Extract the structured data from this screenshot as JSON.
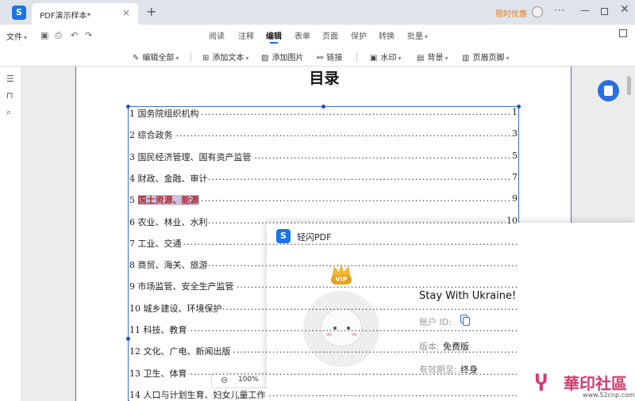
{
  "titlebar": {
    "app_logo": "S",
    "tab_title": "PDF演示样本*",
    "tab_close": "×",
    "tab_add": "+",
    "promo": "限时优惠",
    "more": "···",
    "minimize": "—",
    "close": "✕"
  },
  "menu": {
    "file": "文件",
    "file_caret": "▾",
    "items": [
      {
        "label": "阅读"
      },
      {
        "label": "注释"
      },
      {
        "label": "编辑"
      },
      {
        "label": "表单"
      },
      {
        "label": "页面"
      },
      {
        "label": "保护"
      },
      {
        "label": "转换"
      },
      {
        "label": "批量"
      }
    ],
    "batch_caret": "▾",
    "active_index": 2
  },
  "toolbar": {
    "edit_all": "编辑全部",
    "add_text": "添加文本",
    "add_image": "添加图片",
    "link": "链接",
    "watermark": "水印",
    "background": "背景",
    "header_footer": "页眉页脚",
    "caret": "▾"
  },
  "document": {
    "title": "目录",
    "toc": [
      {
        "num": "1",
        "text": "国务院组织机构",
        "page": "1"
      },
      {
        "num": "2",
        "text": "综合政务",
        "page": "3"
      },
      {
        "num": "3",
        "text": "国民经济管理、国有资产监管",
        "page": "5"
      },
      {
        "num": "4",
        "text": "财政、金融、审计",
        "page": "7"
      },
      {
        "num": "5",
        "text": "国土资源、能源",
        "page": "9"
      },
      {
        "num": "6",
        "text": "农业、林业、水利",
        "page": "10"
      },
      {
        "num": "7",
        "text": "工业、交通",
        "page": ""
      },
      {
        "num": "8",
        "text": "商贸、海关、旅游",
        "page": ""
      },
      {
        "num": "9",
        "text": "市场监管、安全生产监管",
        "page": ""
      },
      {
        "num": "10",
        "text": "城乡建设、环境保护",
        "page": ""
      },
      {
        "num": "11",
        "text": "科技、教育",
        "page": ""
      },
      {
        "num": "12",
        "text": "文化、广电、新闻出版",
        "page": ""
      },
      {
        "num": "13",
        "text": "卫生、体育",
        "page": ""
      },
      {
        "num": "14",
        "text": "人口与计划生育、妇女儿童工作",
        "page": ""
      }
    ],
    "highlight_index": 4,
    "dots": "........................................................................................................................................."
  },
  "zoom": {
    "minus": "⊖",
    "level": "100%"
  },
  "popup": {
    "app_logo": "S",
    "title": "轻闪PDF",
    "vip": "VIP",
    "username": "Stay With Ukraine!",
    "account_id_label": "账户 ID:",
    "version_label": "版本:",
    "version_value": "免费版",
    "expiry_label": "有效期至:",
    "expiry_value": "终身"
  },
  "watermark": {
    "logo": "Ⴤ",
    "text": "華印社區",
    "url": "www.52cnp.com"
  },
  "colors": {
    "accent": "#1a73e8",
    "promo": "#e67e22",
    "highlight_text": "#b3232b",
    "highlight_bg": "#c9c2dc",
    "watermark": "#d23a6e"
  }
}
